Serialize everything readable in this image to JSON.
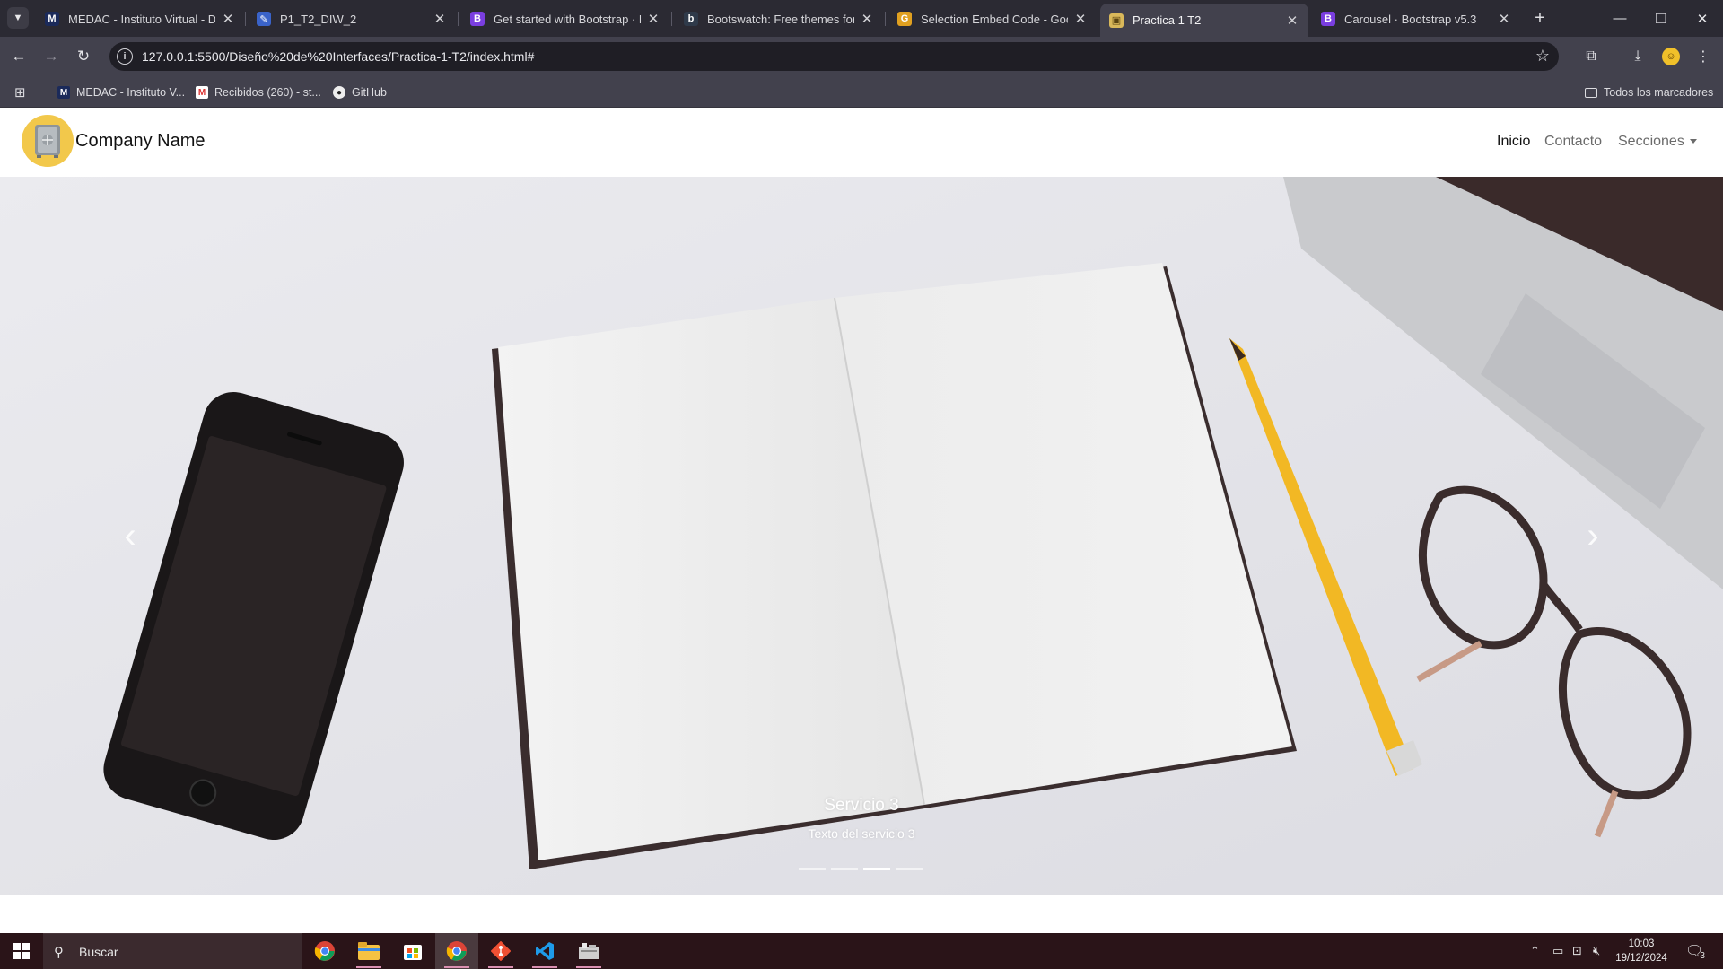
{
  "browser": {
    "tabs": [
      {
        "title": "MEDAC - Instituto Virtual - Doc",
        "icon": "medac-favicon",
        "color": "#1b2a5a"
      },
      {
        "title": "P1_T2_DIW_2",
        "icon": "document-favicon",
        "color": "#3a63c9"
      },
      {
        "title": "Get started with Bootstrap · Bo",
        "icon": "bootstrap-favicon",
        "color": "#7a3ee0"
      },
      {
        "title": "Bootswatch: Free themes for Bo",
        "icon": "bootswatch-favicon",
        "color": "#2f3a4a"
      },
      {
        "title": "Selection Embed Code - Googl",
        "icon": "google-favicon",
        "color": "#e0a020"
      },
      {
        "title": "Practica 1 T2",
        "icon": "page-favicon",
        "color": "#d9b85a"
      },
      {
        "title": "Carousel · Bootstrap v5.3",
        "icon": "bootstrap-favicon",
        "color": "#7a3ee0"
      }
    ],
    "url": "127.0.0.1:5500/Diseño%20de%20Interfaces/Practica-1-T2/index.html#",
    "bookmarks": [
      {
        "label": "MEDAC - Instituto V...",
        "icon": "medac-favicon"
      },
      {
        "label": "Recibidos (260) - st...",
        "icon": "gmail-favicon"
      },
      {
        "label": "GitHub",
        "icon": "github-favicon"
      }
    ],
    "all_bookmarks_label": "Todos los marcadores"
  },
  "site": {
    "brand": "Company Name",
    "nav": {
      "inicio": "Inicio",
      "contacto": "Contacto",
      "secciones": "Secciones"
    },
    "carousel": {
      "caption_title": "Servicio 3",
      "caption_text": "Texto del servicio 3",
      "active_slide": 3,
      "slide_count": 4
    }
  },
  "taskbar": {
    "search_placeholder": "Buscar",
    "time": "10:03",
    "date": "19/12/2024",
    "notifications": "3"
  }
}
